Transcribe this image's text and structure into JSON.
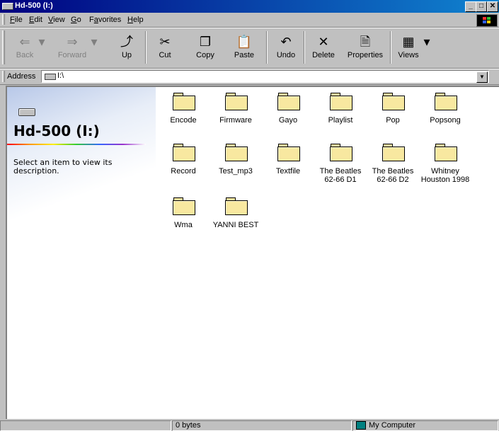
{
  "window": {
    "title": "Hd-500 (I:)",
    "minimize": "_",
    "maximize": "□",
    "close": "✕"
  },
  "menu": [
    {
      "pre": "",
      "key": "F",
      "post": "ile"
    },
    {
      "pre": "",
      "key": "E",
      "post": "dit"
    },
    {
      "pre": "",
      "key": "V",
      "post": "iew"
    },
    {
      "pre": "",
      "key": "G",
      "post": "o"
    },
    {
      "pre": "F",
      "key": "a",
      "post": "vorites"
    },
    {
      "pre": "",
      "key": "H",
      "post": "elp"
    }
  ],
  "toolbar": {
    "back": {
      "label": "Back",
      "icon": "back-arrow-icon",
      "glyph": "⇐"
    },
    "forward": {
      "label": "Forward",
      "icon": "forward-arrow-icon",
      "glyph": "⇒"
    },
    "up": {
      "label": "Up",
      "icon": "up-folder-icon",
      "glyph": "⤴"
    },
    "cut": {
      "label": "Cut",
      "icon": "scissors-icon",
      "glyph": "✂"
    },
    "copy": {
      "label": "Copy",
      "icon": "copy-icon",
      "glyph": "❐"
    },
    "paste": {
      "label": "Paste",
      "icon": "paste-icon",
      "glyph": "📋"
    },
    "undo": {
      "label": "Undo",
      "icon": "undo-icon",
      "glyph": "↶"
    },
    "delete": {
      "label": "Delete",
      "icon": "delete-x-icon",
      "glyph": "✕"
    },
    "properties": {
      "label": "Properties",
      "icon": "properties-icon",
      "glyph": "🗎"
    },
    "views": {
      "label": "Views",
      "icon": "views-grid-icon",
      "glyph": "▦"
    },
    "dropdown": "▾"
  },
  "address": {
    "label": "Address",
    "value": "I:\\",
    "dropdown": "▼"
  },
  "panel": {
    "drive_title": "Hd-500 (I:)",
    "description": "Select an item to view its description."
  },
  "folders": [
    "Encode",
    "Firmware",
    "Gayo",
    "Playlist",
    "Pop",
    "Popsong",
    "Record",
    "Test_mp3",
    "Textfile",
    "The Beatles 62-66 D1",
    "The Beatles 62-66 D2",
    "Whitney Houston 1998",
    "Wma",
    "YANNI BEST"
  ],
  "status": {
    "left": "",
    "size": "0 bytes",
    "zone": "My Computer"
  }
}
